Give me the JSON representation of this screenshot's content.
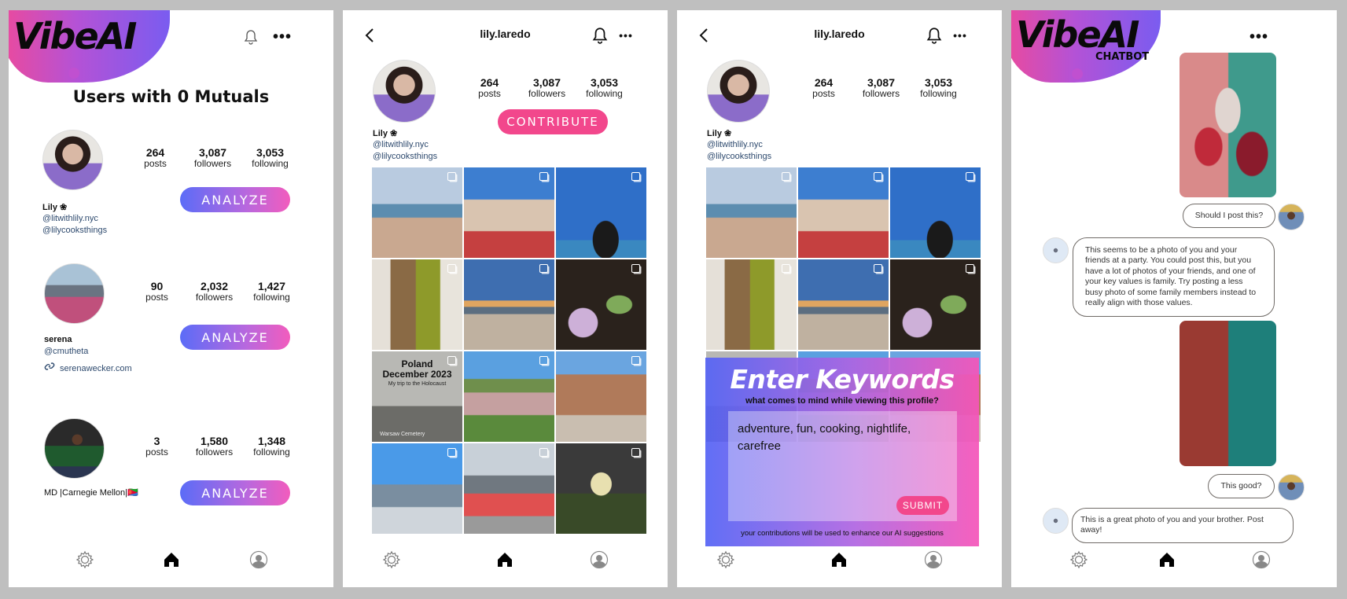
{
  "brand": {
    "logo": "VibeAI",
    "chatbot_sub": "CHATBOT"
  },
  "icons": {
    "bell": "bell-icon",
    "more": "more-icon",
    "back": "back-icon",
    "settings": "gear-icon",
    "home": "home-icon",
    "profile": "profile-icon",
    "link": "link-icon"
  },
  "mutuals_screen": {
    "title": "Users with 0 Mutuals",
    "analyze_label": "ANALYZE",
    "users": [
      {
        "name": "Lily ❀",
        "lines": [
          "@litwithlily.nyc",
          "@lilycooksthings"
        ],
        "posts": "264",
        "followers": "3,087",
        "following": "3,053"
      },
      {
        "name": "serena",
        "lines": [
          "@cmutheta"
        ],
        "link": "serenawecker.com",
        "posts": "90",
        "followers": "2,032",
        "following": "1,427"
      },
      {
        "name": "MD |Carnegie Mellon|🇪🇷",
        "lines": [],
        "posts": "3",
        "followers": "1,580",
        "following": "1,348"
      }
    ],
    "stat_labels": {
      "posts": "posts",
      "followers": "followers",
      "following": "following"
    }
  },
  "profile_screen": {
    "username": "lily.laredo",
    "name": "Lily ❀",
    "handles": [
      "@litwithlily.nyc",
      "@lilycooksthings"
    ],
    "posts": "264",
    "followers": "3,087",
    "following": "3,053",
    "contribute_label": "CONTRIBUTE",
    "grid_post_text": {
      "title": "Poland\nDecember 2023",
      "subtitle": "My trip to the Holocaust",
      "caption": "Warsaw Cemetery"
    }
  },
  "keywords_modal": {
    "title": "Enter Keywords",
    "subtitle": "what comes to mind while viewing this profile?",
    "input_value": "adventure, fun, cooking, nightlife, carefree",
    "submit_label": "SUBMIT",
    "footer": "your contributions will be used to enhance our AI suggestions"
  },
  "chat": {
    "messages": [
      {
        "from": "user",
        "type": "image",
        "alt": "party group photo"
      },
      {
        "from": "user",
        "text": "Should I post this?"
      },
      {
        "from": "bot",
        "text": "This seems to be a photo of you and your friends at a party. You could post this, but you have a lot of photos of your friends, and one of your key values is family. Try posting a less busy photo of some family members instead to really align with those values."
      },
      {
        "from": "user",
        "type": "image",
        "alt": "photo with brother"
      },
      {
        "from": "user",
        "text": "This good?"
      },
      {
        "from": "bot",
        "text": "This is a great photo of you and your brother. Post away!"
      }
    ]
  },
  "colors": {
    "accent_pink": "#f2478c",
    "gradient_start": "#5b6cf7",
    "gradient_end": "#f25cbd",
    "link_blue": "#2e4a6e"
  }
}
